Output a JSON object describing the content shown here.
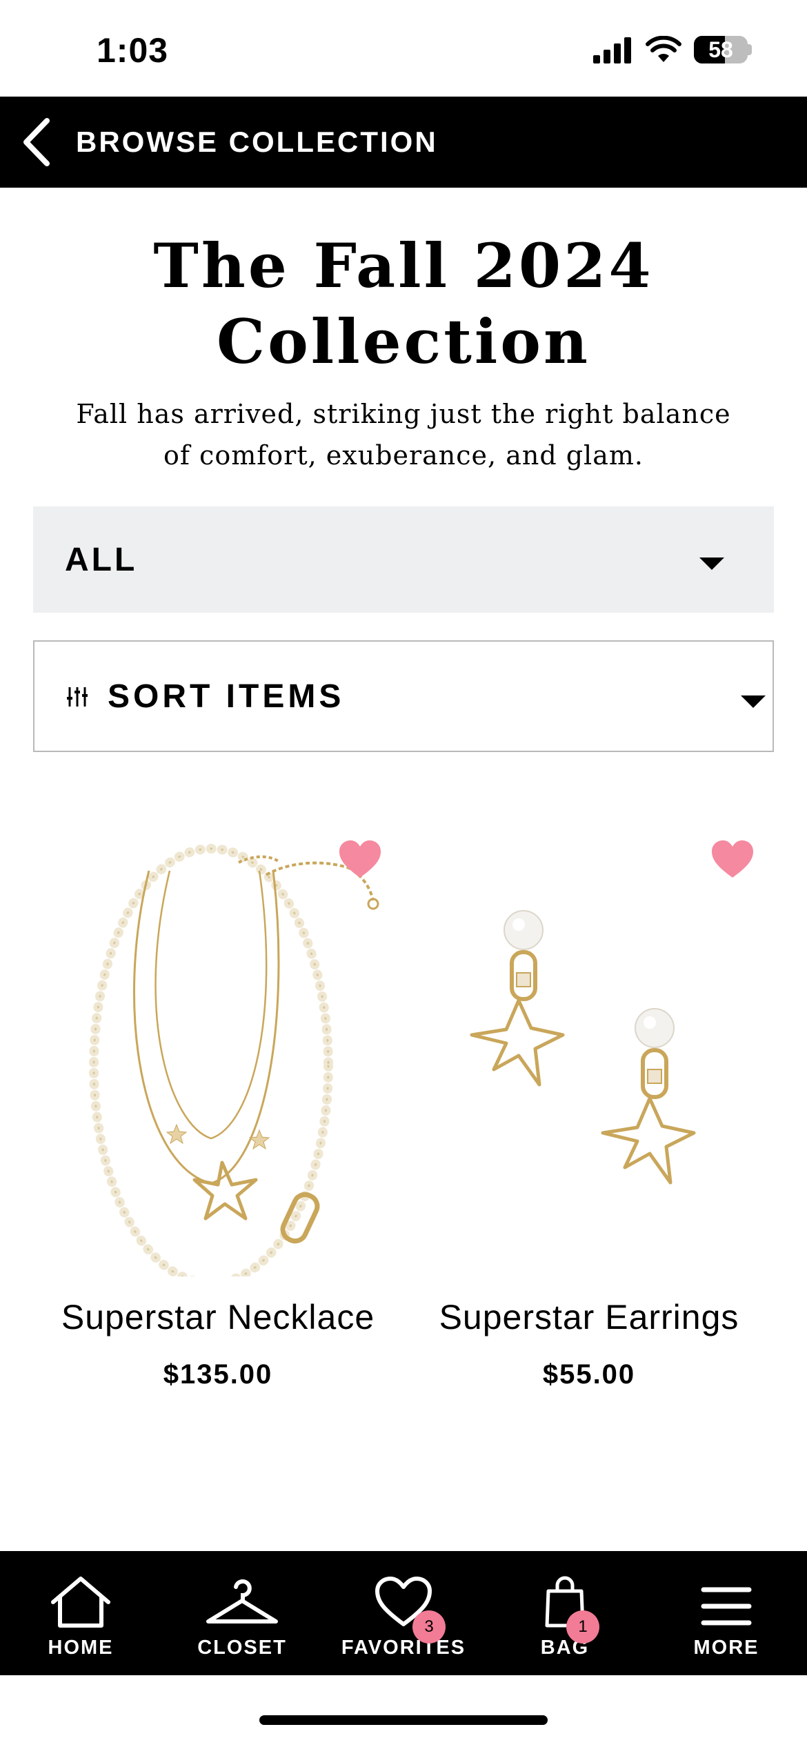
{
  "status_bar": {
    "time": "1:03",
    "battery": "58",
    "battery_level": 0.58
  },
  "header": {
    "title": "BROWSE COLLECTION"
  },
  "page": {
    "title": "The Fall 2024 Collection",
    "subtitle": "Fall has arrived, striking just the right balance of comfort, exuberance, and glam."
  },
  "filter": {
    "selected": "ALL"
  },
  "sort": {
    "label": "SORT ITEMS"
  },
  "products": [
    {
      "name": "Superstar Necklace",
      "price": "$135.00",
      "favorited": true
    },
    {
      "name": "Superstar Earrings",
      "price": "$55.00",
      "favorited": true
    }
  ],
  "bottom_nav": [
    {
      "label": "HOME",
      "icon": "home-icon"
    },
    {
      "label": "CLOSET",
      "icon": "hanger-icon"
    },
    {
      "label": "FAVORITES",
      "icon": "heart-icon",
      "badge": "3"
    },
    {
      "label": "BAG",
      "icon": "shopping-bag-icon",
      "badge": "1"
    },
    {
      "label": "MORE",
      "icon": "menu-icon"
    }
  ],
  "colors": {
    "accent_pink": "#f27b96",
    "header_bg": "#000000",
    "filter_bg": "#eeeff0",
    "gold": "#c9a65a"
  }
}
